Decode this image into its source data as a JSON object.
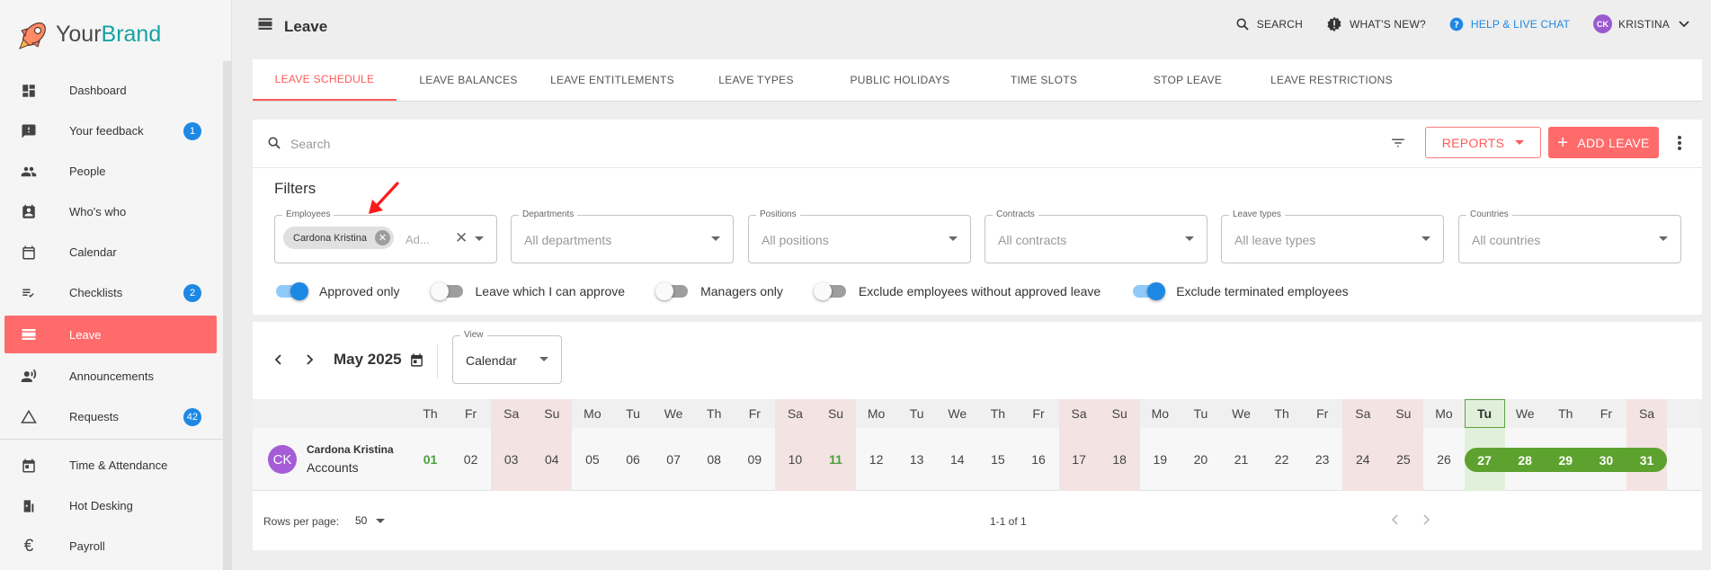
{
  "brand": {
    "your": "Your",
    "name": "Brand"
  },
  "sidebar": {
    "items": [
      {
        "label": "Dashboard",
        "icon": "dashboard-icon"
      },
      {
        "label": "Your feedback",
        "icon": "feedback-icon",
        "badge": "1"
      },
      {
        "label": "People",
        "icon": "people-icon"
      },
      {
        "label": "Who's who",
        "icon": "contacts-icon"
      },
      {
        "label": "Calendar",
        "icon": "calendar-icon"
      },
      {
        "label": "Checklists",
        "icon": "checklist-icon",
        "badge": "2"
      },
      {
        "label": "Leave",
        "icon": "leave-icon",
        "active": true
      },
      {
        "label": "Announcements",
        "icon": "announcement-icon"
      },
      {
        "label": "Requests",
        "icon": "requests-icon",
        "badge": "42"
      },
      {
        "label": "Time & Attendance",
        "icon": "time-attendance-icon"
      },
      {
        "label": "Hot Desking",
        "icon": "hot-desking-icon"
      },
      {
        "label": "Payroll",
        "icon": "euro-icon"
      }
    ]
  },
  "header": {
    "title": "Leave",
    "search": "SEARCH",
    "whats_new": "WHAT'S NEW?",
    "help": "HELP & LIVE CHAT",
    "user_initials": "CK",
    "user_name": "KRISTINA"
  },
  "tabs": [
    {
      "label": "LEAVE SCHEDULE",
      "active": true
    },
    {
      "label": "LEAVE BALANCES"
    },
    {
      "label": "LEAVE ENTITLEMENTS"
    },
    {
      "label": "LEAVE TYPES"
    },
    {
      "label": "PUBLIC HOLIDAYS"
    },
    {
      "label": "TIME SLOTS"
    },
    {
      "label": "STOP LEAVE"
    },
    {
      "label": "LEAVE RESTRICTIONS"
    }
  ],
  "toolbar": {
    "search_placeholder": "Search",
    "reports_label": "REPORTS",
    "add_leave_label": "ADD LEAVE"
  },
  "filters": {
    "title": "Filters",
    "employees": {
      "label": "Employees",
      "chip": "Cardona Kristina",
      "placeholder": "Ad..."
    },
    "departments": {
      "label": "Departments",
      "value": "All departments"
    },
    "positions": {
      "label": "Positions",
      "value": "All positions"
    },
    "contracts": {
      "label": "Contracts",
      "value": "All contracts"
    },
    "leave_types": {
      "label": "Leave types",
      "value": "All leave types"
    },
    "countries": {
      "label": "Countries",
      "value": "All countries"
    },
    "toggles": [
      {
        "label": "Approved only",
        "on": true
      },
      {
        "label": "Leave which I can approve",
        "on": false
      },
      {
        "label": "Managers only",
        "on": false
      },
      {
        "label": "Exclude employees without approved leave",
        "on": false
      },
      {
        "label": "Exclude terminated employees",
        "on": true
      }
    ]
  },
  "calendar": {
    "month": "May 2025",
    "view_label": "View",
    "view_value": "Calendar",
    "weekdays": [
      "Th",
      "Fr",
      "Sa",
      "Su",
      "Mo",
      "Tu",
      "We",
      "Th",
      "Fr",
      "Sa",
      "Su",
      "Mo",
      "Tu",
      "We",
      "Th",
      "Fr",
      "Sa",
      "Su",
      "Mo",
      "Tu",
      "We",
      "Th",
      "Fr",
      "Sa",
      "Su",
      "Mo",
      "Tu",
      "We",
      "Th",
      "Fr",
      "Sa"
    ],
    "days": [
      "01",
      "02",
      "03",
      "04",
      "05",
      "06",
      "07",
      "08",
      "09",
      "10",
      "11",
      "12",
      "13",
      "14",
      "15",
      "16",
      "17",
      "18",
      "19",
      "20",
      "21",
      "22",
      "23",
      "24",
      "25",
      "26",
      "27",
      "28",
      "29",
      "30",
      "31"
    ],
    "weekend_index": [
      2,
      3,
      9,
      10,
      16,
      17,
      23,
      24,
      30
    ],
    "holiday_index": [
      0,
      10
    ],
    "today_index": 26,
    "leave_range": [
      26,
      30
    ],
    "employee": {
      "initials": "CK",
      "name": "Cardona Kristina",
      "department": "Accounts"
    }
  },
  "pager": {
    "rows_label": "Rows per page:",
    "rows_value": "50",
    "info": "1-1 of 1"
  },
  "colors": {
    "accent": "#ff6b6b",
    "primary": "#1e88e5",
    "leave_green": "#5da22f",
    "weekend": "#f3e3e3",
    "brand_teal": "#17a3a3"
  }
}
